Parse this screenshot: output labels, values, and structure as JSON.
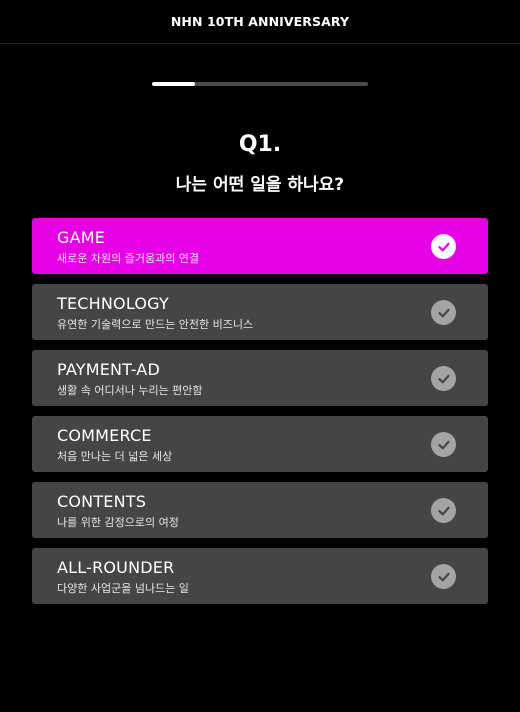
{
  "header": {
    "title": "NHN 10TH ANNIVERSARY"
  },
  "progress": {
    "value": 0.2
  },
  "question": {
    "number": "Q1.",
    "text": "나는 어떤 일을 하나요?"
  },
  "colors": {
    "selected": "#e600e6",
    "unselected": "#454545"
  },
  "options": [
    {
      "title": "GAME",
      "subtitle": "새로운 차원의 즐거움과의 연결",
      "selected": true
    },
    {
      "title": "TECHNOLOGY",
      "subtitle": "유연한 기술력으로 만드는 안전한 비즈니스",
      "selected": false
    },
    {
      "title": "PAYMENT-AD",
      "subtitle": "생활 속 어디서나 누리는 편안함",
      "selected": false
    },
    {
      "title": "COMMERCE",
      "subtitle": "처음 만나는 더 넓은 세상",
      "selected": false
    },
    {
      "title": "CONTENTS",
      "subtitle": "나를 위한 감정으로의 여정",
      "selected": false
    },
    {
      "title": "ALL-ROUNDER",
      "subtitle": "다양한 사업군을 넘나드는 일",
      "selected": false
    }
  ]
}
